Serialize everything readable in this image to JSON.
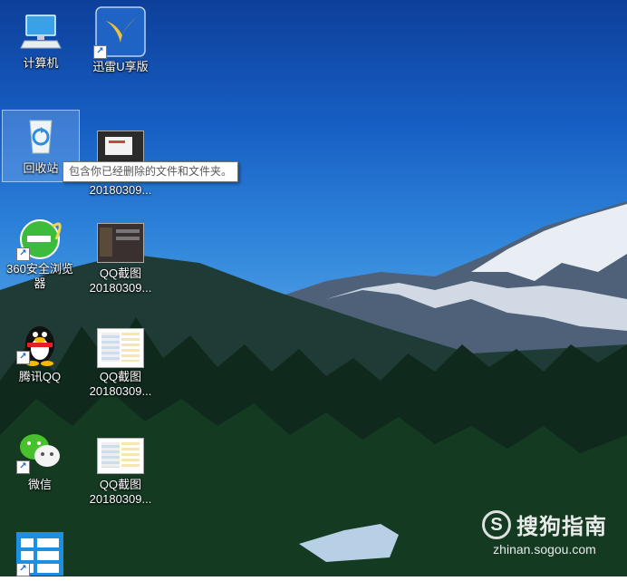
{
  "desktop": {
    "icons": [
      {
        "label": "计算机",
        "icon": "computer-icon"
      },
      {
        "label": "迅雷U享版",
        "icon": "thunder-bird-icon"
      },
      {
        "label": "回收站",
        "icon": "recycle-bin-icon",
        "selected": true
      },
      {
        "label": "20180309...",
        "icon": "screenshot-thumbnail-icon"
      },
      {
        "label": "360安全浏览\n器",
        "icon": "ie-360-browser-icon"
      },
      {
        "label": "QQ截图\n20180309...",
        "icon": "screenshot-thumbnail-icon"
      },
      {
        "label": "腾讯QQ",
        "icon": "qq-penguin-icon"
      },
      {
        "label": "QQ截图\n20180309...",
        "icon": "screenshot-thumbnail-icon"
      },
      {
        "label": "微信",
        "icon": "wechat-icon"
      },
      {
        "label": "QQ截图\n20180309...",
        "icon": "screenshot-thumbnail-icon"
      },
      {
        "label": "",
        "icon": "app-grid-icon"
      }
    ],
    "tooltip": "包含你已经删除的文件和文件夹。"
  },
  "watermark": {
    "brand": "搜狗指南",
    "logo_letter": "S",
    "url": "zhinan.sogou.com"
  }
}
